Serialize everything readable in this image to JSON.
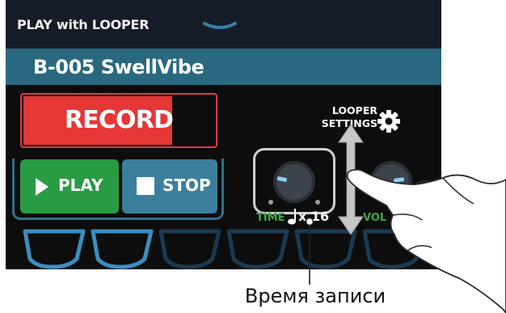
{
  "header": {
    "title": "PLAY with LOOPER"
  },
  "patch": {
    "name": "B-005 SwellVibe"
  },
  "looper": {
    "record_label": "RECORD",
    "play_label": "PLAY",
    "stop_label": "STOP",
    "settings_line1": "LOOPER",
    "settings_line2": "SETTINGS",
    "time_label": "TIME",
    "time_value": "x 16",
    "vol_label": "VOL"
  },
  "annotation": {
    "caption": "Время записи"
  },
  "colors": {
    "record": "#e63636",
    "play": "#2a9b45",
    "stop": "#3c7f9c",
    "patch_bar": "#2a6880",
    "param_label": "#3ca84a"
  },
  "icons": [
    "chevron-down-icon",
    "play-icon",
    "stop-icon",
    "gear-icon",
    "quarter-note-icon",
    "up-down-arrow-icon"
  ]
}
